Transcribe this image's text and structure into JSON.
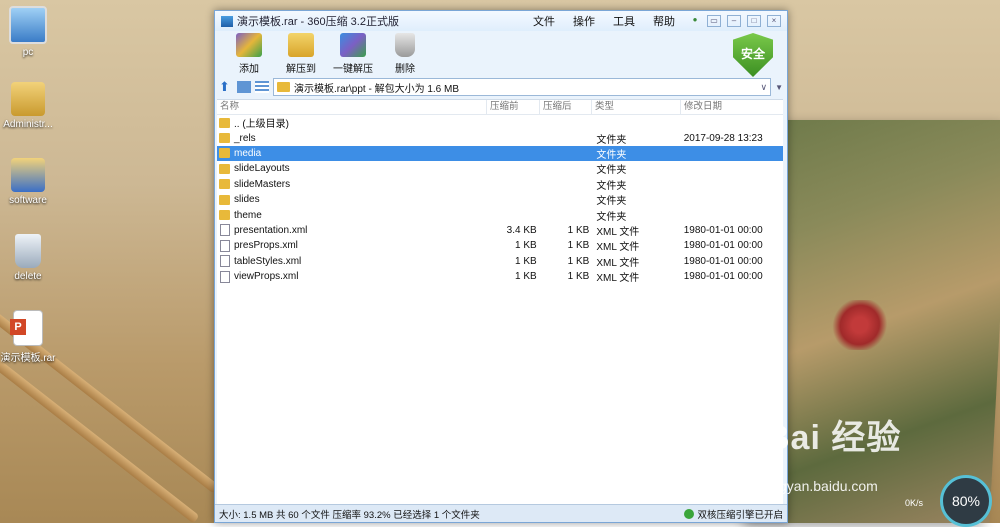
{
  "desktop": {
    "icons": [
      {
        "label": "pc",
        "icon": "computer-icon"
      },
      {
        "label": "Administr...",
        "icon": "user-folder-icon"
      },
      {
        "label": "software",
        "icon": "software-icon"
      },
      {
        "label": "delete",
        "icon": "recycle-bin-icon"
      },
      {
        "label": "演示模板.rar",
        "icon": "ppt-file-icon"
      }
    ]
  },
  "window": {
    "title": "演示模板.rar - 360压缩 3.2正式版",
    "menus": [
      "文件",
      "操作",
      "工具",
      "帮助"
    ],
    "toolbar": [
      {
        "label": "添加",
        "icon": "add-archive-icon"
      },
      {
        "label": "解压到",
        "icon": "extract-to-icon"
      },
      {
        "label": "一键解压",
        "icon": "one-click-extract-icon"
      },
      {
        "label": "删除",
        "icon": "delete-icon"
      }
    ],
    "security_badge": "安全",
    "address": "演示模板.rar\\ppt - 解包大小为 1.6 MB",
    "columns": [
      "名称",
      "压缩前",
      "压缩后",
      "类型",
      "修改日期"
    ],
    "files": [
      {
        "name": ".. (上级目录)",
        "kind": "folder",
        "comp": "",
        "orig": "",
        "type": "",
        "date": "",
        "selected": false
      },
      {
        "name": "_rels",
        "kind": "folder",
        "comp": "",
        "orig": "",
        "type": "文件夹",
        "date": "2017-09-28 13:23",
        "selected": false
      },
      {
        "name": "media",
        "kind": "folder",
        "comp": "",
        "orig": "",
        "type": "文件夹",
        "date": "",
        "selected": true
      },
      {
        "name": "slideLayouts",
        "kind": "folder",
        "comp": "",
        "orig": "",
        "type": "文件夹",
        "date": "",
        "selected": false
      },
      {
        "name": "slideMasters",
        "kind": "folder",
        "comp": "",
        "orig": "",
        "type": "文件夹",
        "date": "",
        "selected": false
      },
      {
        "name": "slides",
        "kind": "folder",
        "comp": "",
        "orig": "",
        "type": "文件夹",
        "date": "",
        "selected": false
      },
      {
        "name": "theme",
        "kind": "folder",
        "comp": "",
        "orig": "",
        "type": "文件夹",
        "date": "",
        "selected": false
      },
      {
        "name": "presentation.xml",
        "kind": "file",
        "comp": "3.4 KB",
        "orig": "1 KB",
        "type": "XML 文件",
        "date": "1980-01-01 00:00",
        "selected": false
      },
      {
        "name": "presProps.xml",
        "kind": "file",
        "comp": "1 KB",
        "orig": "1 KB",
        "type": "XML 文件",
        "date": "1980-01-01 00:00",
        "selected": false
      },
      {
        "name": "tableStyles.xml",
        "kind": "file",
        "comp": "1 KB",
        "orig": "1 KB",
        "type": "XML 文件",
        "date": "1980-01-01 00:00",
        "selected": false
      },
      {
        "name": "viewProps.xml",
        "kind": "file",
        "comp": "1 KB",
        "orig": "1 KB",
        "type": "XML 文件",
        "date": "1980-01-01 00:00",
        "selected": false
      }
    ],
    "status_left": "大小: 1.5 MB 共 60 个文件 压缩率 93.2% 已经选择 1 个文件夹",
    "status_right": "双核压缩引擎已开启"
  },
  "overlay": {
    "watermark": "Bai 经验",
    "watermark_url": "jingyan.baidu.com",
    "gauge": "80%",
    "net_speed": "0K/s"
  },
  "colors": {
    "selection": "#3d8ee6",
    "shield": "#4a9e2a"
  }
}
